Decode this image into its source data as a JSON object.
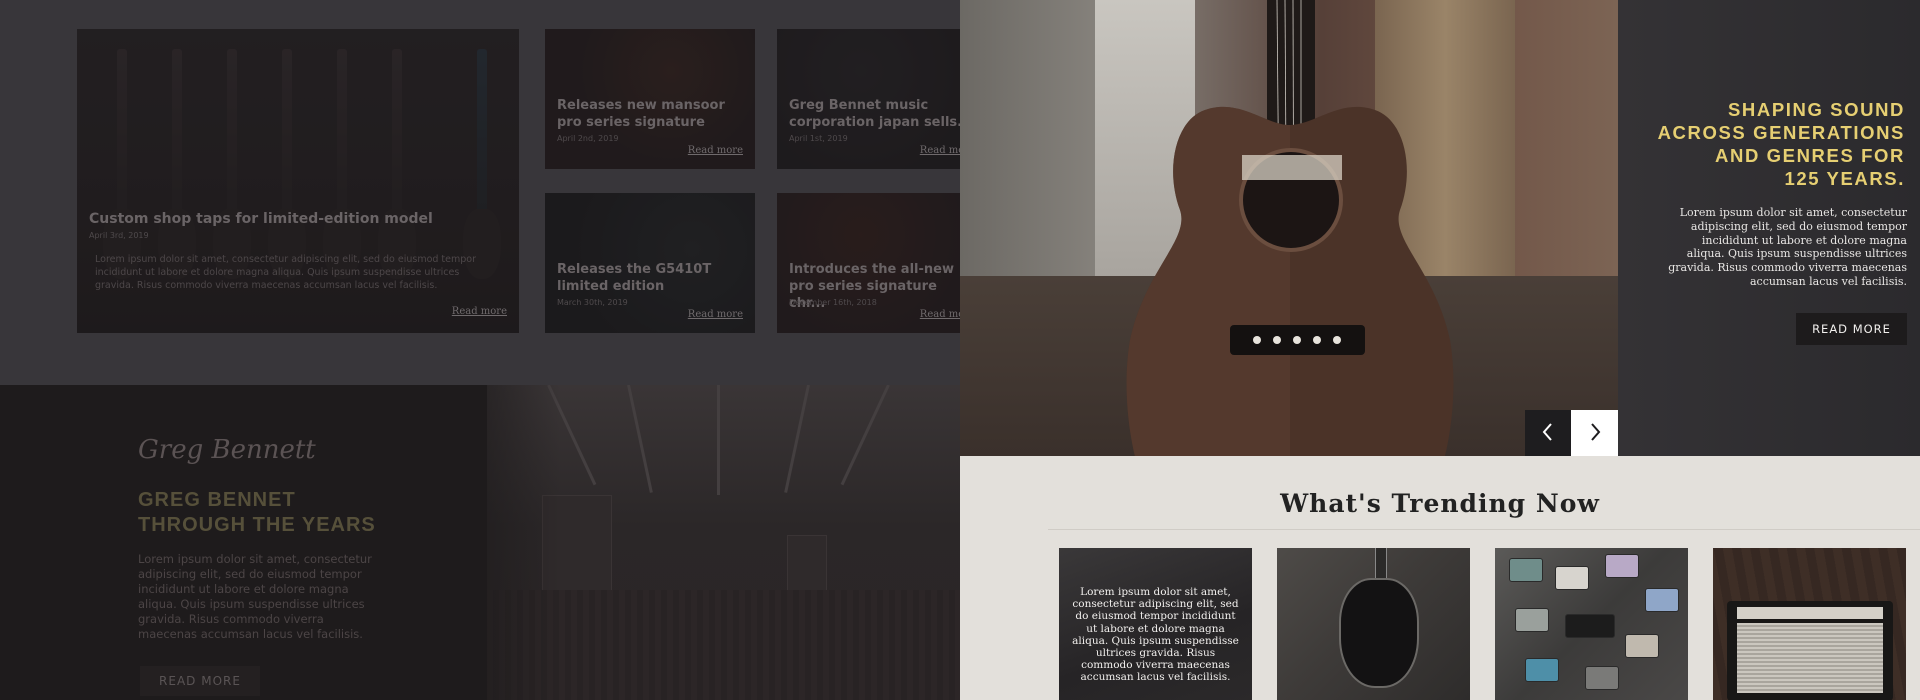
{
  "news": {
    "featured": {
      "title": "Custom shop taps for limited-edition model",
      "date": "April 3rd, 2019",
      "body": "Lorem ipsum dolor sit amet, consectetur adipiscing elit, sed do eiusmod tempor incididunt ut labore et dolore magna aliqua. Quis ipsum suspendisse ultrices gravida. Risus commodo viverra maecenas accumsan lacus vel facilisis.",
      "read_more": "Read more"
    },
    "cards": [
      {
        "title": "Releases new mansoor pro series signature",
        "date": "April 2nd, 2019",
        "read_more": "Read more"
      },
      {
        "title": "Greg Bennet music corporation japan sells...",
        "date": "April 1st, 2019",
        "read_more": "Read more"
      },
      {
        "title": "Releases the G5410T limited edition",
        "date": "March 30th, 2019",
        "read_more": "Read more"
      },
      {
        "title": "Introduces the all-new pro series signature chr...",
        "date": "December 16th, 2018",
        "read_more": "Read more"
      }
    ]
  },
  "history": {
    "signature": "Greg Bennett",
    "title_line1": "GREG BENNET",
    "title_line2": "THROUGH THE YEARS",
    "body": "Lorem ipsum dolor sit amet, consectetur adipiscing elit, sed do eiusmod tempor incididunt ut labore et dolore magna aliqua. Quis ipsum suspendisse ultrices gravida. Risus commodo viverra maecenas accumsan lacus vel facilisis.",
    "button": "READ MORE"
  },
  "hero": {
    "title_lines": [
      "SHAPING SOUND",
      "ACROSS GENERATIONS",
      "AND GENRES FOR",
      "125 YEARS."
    ],
    "body": "Lorem ipsum dolor sit amet, consectetur adipiscing elit, sed do eiusmod tempor incididunt ut labore et dolore magna aliqua. Quis ipsum suspendisse ultrices gravida. Risus commodo viverra maecenas accumsan lacus vel facilisis.",
    "button": "READ MORE",
    "prev_icon": "chevron-left-icon",
    "next_icon": "chevron-right-icon",
    "accent_color": "#e6cf72"
  },
  "trending": {
    "title": "What's Trending Now",
    "first_tile_caption": "Lorem ipsum dolor sit amet, consectetur adipiscing elit, sed do eiusmod tempor incididunt ut labore et dolore magna aliqua. Quis ipsum suspendisse ultrices gravida. Risus commodo viverra maecenas accumsan lacus vel facilisis."
  }
}
